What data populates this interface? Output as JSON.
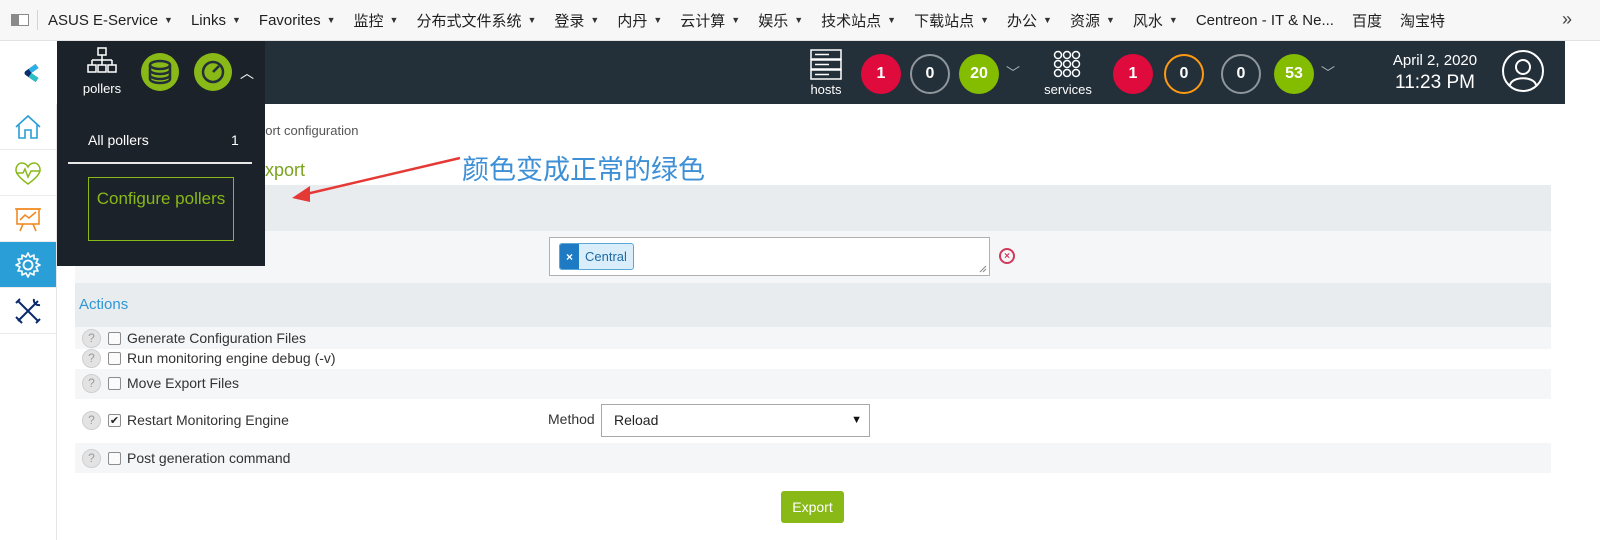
{
  "bookmarks": {
    "items": [
      {
        "label": "ASUS E-Service",
        "caret": true
      },
      {
        "label": "Links",
        "caret": true
      },
      {
        "label": "Favorites",
        "caret": true
      },
      {
        "label": "监控",
        "caret": true
      },
      {
        "label": "分布式文件系统",
        "caret": true
      },
      {
        "label": "登录",
        "caret": true
      },
      {
        "label": "内丹",
        "caret": true
      },
      {
        "label": "云计算",
        "caret": true
      },
      {
        "label": "娱乐",
        "caret": true
      },
      {
        "label": "技术站点",
        "caret": true
      },
      {
        "label": "下载站点",
        "caret": true
      },
      {
        "label": "办公",
        "caret": true
      },
      {
        "label": "资源",
        "caret": true
      },
      {
        "label": "风水",
        "caret": true
      },
      {
        "label": "Centreon - IT & Ne...",
        "caret": false
      },
      {
        "label": "百度",
        "caret": false
      },
      {
        "label": "淘宝特",
        "caret": false
      }
    ],
    "more": "»"
  },
  "topbar": {
    "pollers_label": "pollers",
    "hosts_label": "hosts",
    "services_label": "services",
    "hosts_counts": {
      "critical": "1",
      "unreachable": "0",
      "ok": "20"
    },
    "services_counts": {
      "critical": "1",
      "warning": "0",
      "unknown": "0",
      "ok": "53"
    },
    "date": "April 2, 2020",
    "time": "11:23 PM"
  },
  "poller_dropdown": {
    "all_pollers_label": "All pollers",
    "all_pollers_count": "1",
    "configure_label": "Configure pollers"
  },
  "page": {
    "breadcrumb": "port configuration",
    "heading": "xport",
    "annotation": "颜色变成正常的绿色"
  },
  "form": {
    "selected_poller": "Central",
    "actions_title": "Actions",
    "actions": [
      {
        "label": "Generate Configuration Files",
        "checked": false
      },
      {
        "label": "Run monitoring engine debug (-v)",
        "checked": false
      },
      {
        "label": "Move Export Files",
        "checked": false
      },
      {
        "label": "Restart Monitoring Engine",
        "checked": true
      },
      {
        "label": "Post generation command",
        "checked": false
      }
    ],
    "method_label": "Method",
    "method_value": "Reload",
    "export_label": "Export"
  },
  "colors": {
    "topbar": "#232f39",
    "green": "#88b917",
    "red": "#e00b3d",
    "orange": "#ff9a13",
    "blue": "#2a9ed6"
  }
}
